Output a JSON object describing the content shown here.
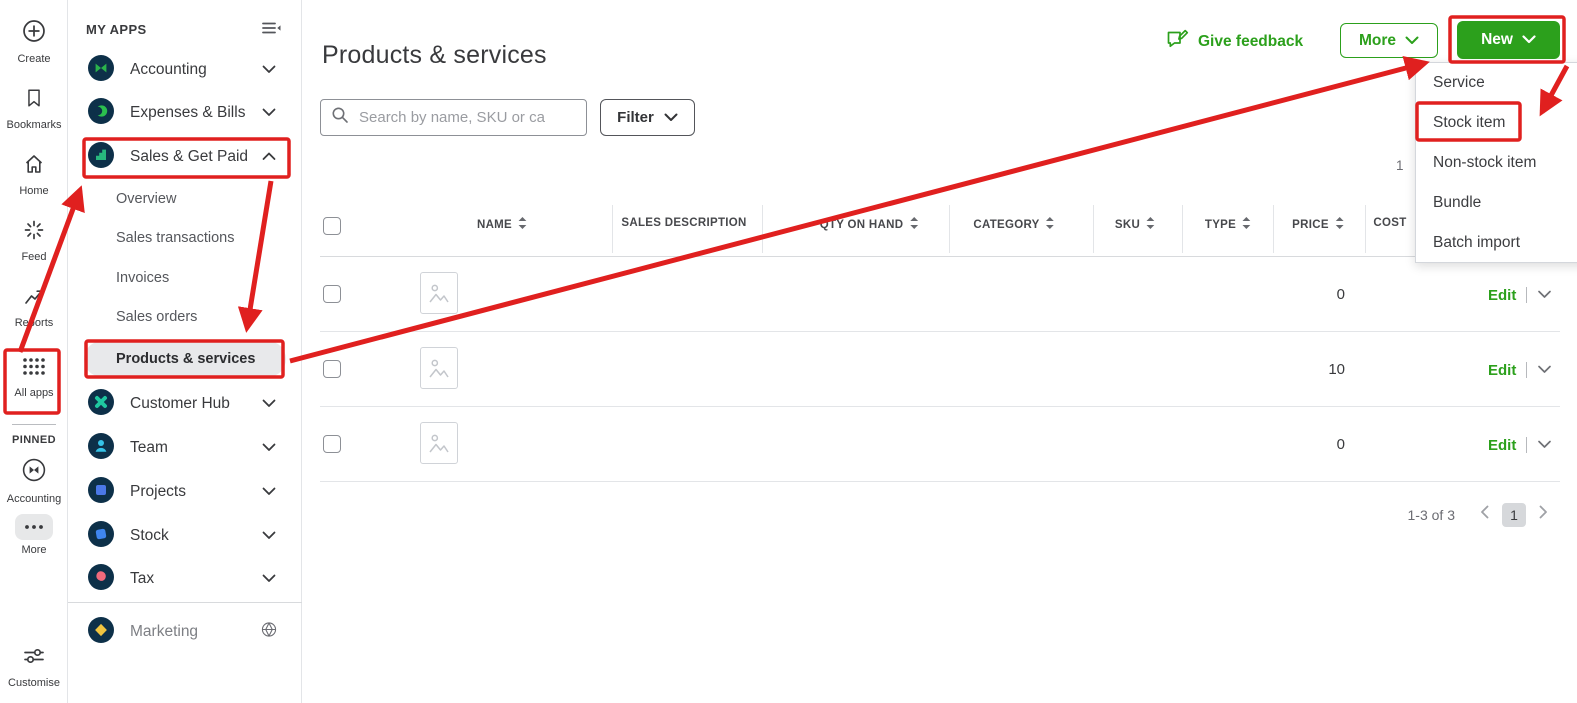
{
  "colors": {
    "accent_green": "#2ca01c",
    "annotation_red": "#e0201f",
    "app_navy": "#0d3049"
  },
  "rail": {
    "items": [
      {
        "label": "Create"
      },
      {
        "label": "Bookmarks"
      },
      {
        "label": "Home"
      },
      {
        "label": "Feed"
      },
      {
        "label": "Reports"
      },
      {
        "label": "All apps"
      }
    ],
    "pinned_heading": "PINNED",
    "pinned_items": [
      {
        "label": "Accounting"
      },
      {
        "label": "More"
      }
    ],
    "customise_label": "Customise"
  },
  "sidebar": {
    "heading": "MY APPS",
    "apps": [
      {
        "label": "Accounting"
      },
      {
        "label": "Expenses & Bills"
      },
      {
        "label": "Sales & Get Paid"
      },
      {
        "label": "Customer Hub"
      },
      {
        "label": "Team"
      },
      {
        "label": "Projects"
      },
      {
        "label": "Stock"
      },
      {
        "label": "Tax"
      },
      {
        "label": "Marketing"
      }
    ],
    "sales_sub_items": [
      {
        "label": "Overview"
      },
      {
        "label": "Sales transactions"
      },
      {
        "label": "Invoices"
      },
      {
        "label": "Sales orders"
      },
      {
        "label": "Products & services"
      }
    ]
  },
  "header": {
    "title": "Products & services",
    "give_feedback_label": "Give feedback",
    "more_label": "More",
    "new_label": "New"
  },
  "toolbar": {
    "search_placeholder": "Search by name, SKU or ca",
    "filter_label": "Filter"
  },
  "table": {
    "columns": [
      {
        "label": "NAME"
      },
      {
        "label": "SALES DESCRIPTION"
      },
      {
        "label": "QTY ON HAND"
      },
      {
        "label": "CATEGORY"
      },
      {
        "label": "SKU"
      },
      {
        "label": "TYPE"
      },
      {
        "label": "PRICE"
      },
      {
        "label": "COST"
      }
    ],
    "rows": [
      {
        "price": "0",
        "edit_label": "Edit"
      },
      {
        "price": "10",
        "edit_label": "Edit"
      },
      {
        "price": "0",
        "edit_label": "Edit"
      }
    ]
  },
  "new_menu": {
    "items": [
      {
        "label": "Service"
      },
      {
        "label": "Stock item"
      },
      {
        "label": "Non-stock item"
      },
      {
        "label": "Bundle"
      },
      {
        "label": "Batch import"
      }
    ]
  },
  "pagination": {
    "summary": "1-3 of 3",
    "current_page": "1",
    "top_partial": "1"
  }
}
